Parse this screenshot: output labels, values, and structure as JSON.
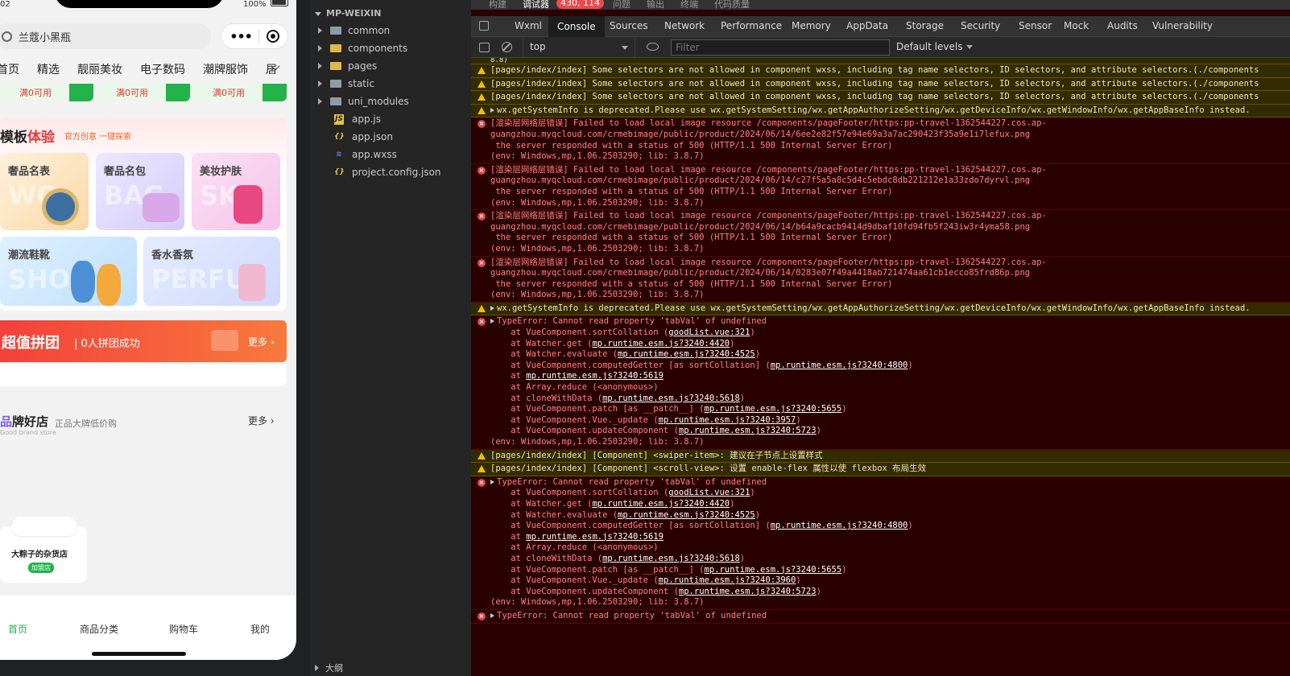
{
  "phone": {
    "status_time": "02",
    "status_battery": "100%",
    "search_text": "兰蔻小黑瓶",
    "tabs": [
      "首页",
      "精选",
      "靓丽美妆",
      "电子数码",
      "潮牌服饰",
      "居"
    ],
    "coupons": [
      "满0可用",
      "满0可用",
      "满0可用"
    ],
    "template_title_a": "模板",
    "template_title_b": "体验",
    "template_sub": "官方创意 一键探索",
    "tiles": [
      {
        "label": "奢品名表",
        "wm": "WO"
      },
      {
        "label": "奢品名包",
        "wm": "BAG"
      },
      {
        "label": "美妆护肤",
        "wm": "SKI"
      },
      {
        "label": "潮流鞋靴",
        "wm": "SHO"
      },
      {
        "label": "香水香氛",
        "wm": "PERFU"
      }
    ],
    "group_title": "超值拼团",
    "group_sub": "| 0人拼团成功",
    "group_more": "更多 ›",
    "brand_title_a": "品",
    "brand_title_b": "牌好店",
    "brand_sub": "正品大牌低价购",
    "brand_en": "Good brand store",
    "brand_more": "更多 ›",
    "shop_name": "大粽子的杂货店",
    "shop_badge": "加盟店",
    "tabbar": [
      "首页",
      "商品分类",
      "购物车",
      "我的"
    ],
    "colors": {
      "accent": "#24b24a",
      "red": "#e4393c"
    }
  },
  "tree": {
    "root": "MP-WEIXIN",
    "folders": [
      "common",
      "components",
      "pages",
      "static",
      "uni_modules"
    ],
    "files": [
      {
        "name": "app.js",
        "icon": "js-icon"
      },
      {
        "name": "app.json",
        "icon": "json-icon"
      },
      {
        "name": "app.wxss",
        "icon": "wxss-icon"
      },
      {
        "name": "project.config.json",
        "icon": "json-icon"
      }
    ],
    "outline": "大纲"
  },
  "devtools": {
    "top_tabs": [
      "构建",
      "调试器",
      "问题",
      "输出",
      "终端",
      "代码质量"
    ],
    "badge": "430, 114",
    "panels": [
      "Wxml",
      "Console",
      "Sources",
      "Network",
      "Performance",
      "Memory",
      "AppData",
      "Storage",
      "Security",
      "Sensor",
      "Mock",
      "Audits",
      "Vulnerability"
    ],
    "context": "top",
    "filter_placeholder": "Filter",
    "levels": "Default levels",
    "top_fragment": "8.8)",
    "logs": [
      {
        "type": "w",
        "lines": [
          "[pages/index/index] Some selectors are not allowed in component wxss, including tag name selectors, ID selectors, and attribute selectors.(./components"
        ]
      },
      {
        "type": "w",
        "lines": [
          "[pages/index/index] Some selectors are not allowed in component wxss, including tag name selectors, ID selectors, and attribute selectors.(./components"
        ]
      },
      {
        "type": "w",
        "lines": [
          "[pages/index/index] Some selectors are not allowed in component wxss, including tag name selectors, ID selectors, and attribute selectors.(./components"
        ]
      },
      {
        "type": "w",
        "tri": true,
        "lines": [
          "wx.getSystemInfo is deprecated.Please use wx.getSystemSetting/wx.getAppAuthorizeSetting/wx.getDeviceInfo/wx.getWindowInfo/wx.getAppBaseInfo instead."
        ]
      },
      {
        "type": "e",
        "lines": [
          "[渲染层网络层错误] Failed to load local image resource /components/pageFooter/https:pp-travel-1362544227.cos.ap-",
          "guangzhou.myqcloud.com/crmebimage/public/product/2024/06/14/6ee2e82f57e94e69a3a7ac290423f35a9e1i7lefux.png",
          " the server responded with a status of 500 (HTTP/1.1 500 Internal Server Error)",
          "(env: Windows,mp,1.06.2503290; lib: 3.8.7)"
        ]
      },
      {
        "type": "e",
        "lines": [
          "[渲染层网络层错误] Failed to load local image resource /components/pageFooter/https:pp-travel-1362544227.cos.ap-",
          "guangzhou.myqcloud.com/crmebimage/public/product/2024/06/14/c27f5a5a8c5d4c5ebdc8db221212e1a33zdo7dyrvl.png",
          " the server responded with a status of 500 (HTTP/1.1 500 Internal Server Error)",
          "(env: Windows,mp,1.06.2503290; lib: 3.8.7)"
        ]
      },
      {
        "type": "e",
        "lines": [
          "[渲染层网络层错误] Failed to load local image resource /components/pageFooter/https:pp-travel-1362544227.cos.ap-",
          "guangzhou.myqcloud.com/crmebimage/public/product/2024/06/14/b64a9cacb9414d9dbaf10fd94fb5f243iw3r4yma58.png",
          " the server responded with a status of 500 (HTTP/1.1 500 Internal Server Error)",
          "(env: Windows,mp,1.06.2503290; lib: 3.8.7)"
        ]
      },
      {
        "type": "e",
        "lines": [
          "[渲染层网络层错误] Failed to load local image resource /components/pageFooter/https:pp-travel-1362544227.cos.ap-",
          "guangzhou.myqcloud.com/crmebimage/public/product/2024/06/14/0283e07f49a4418ab721474aa61cb1ecco85frd86p.png",
          " the server responded with a status of 500 (HTTP/1.1 500 Internal Server Error)",
          "(env: Windows,mp,1.06.2503290; lib: 3.8.7)"
        ]
      },
      {
        "type": "w",
        "tri": true,
        "lines": [
          "wx.getSystemInfo is deprecated.Please use wx.getSystemSetting/wx.getAppAuthorizeSetting/wx.getDeviceInfo/wx.getWindowInfo/wx.getAppBaseInfo instead."
        ]
      },
      {
        "type": "e",
        "tri": true,
        "lines": [
          "TypeError: Cannot read property 'tabVal' of undefined",
          "    at VueComponent.sortCollation (goodList.vue:321)",
          "    at Watcher.get (mp.runtime.esm.js?3240:4420)",
          "    at Watcher.evaluate (mp.runtime.esm.js?3240:4525)",
          "    at VueComponent.computedGetter [as sortCollation] (mp.runtime.esm.js?3240:4800)",
          "    at mp.runtime.esm.js?3240:5619",
          "    at Array.reduce (<anonymous>)",
          "    at cloneWithData (mp.runtime.esm.js?3240:5618)",
          "    at VueComponent.patch [as __patch__] (mp.runtime.esm.js?3240:5655)",
          "    at VueComponent.Vue._update (mp.runtime.esm.js?3240:3957)",
          "    at VueComponent.updateComponent (mp.runtime.esm.js?3240:5723)",
          "(env: Windows,mp,1.06.2503290; lib: 3.8.7)"
        ]
      },
      {
        "type": "w",
        "lines": [
          "[pages/index/index] [Component] <swiper-item>: 建议在子节点上设置样式"
        ]
      },
      {
        "type": "w",
        "lines": [
          "[pages/index/index] [Component] <scroll-view>: 设置 enable-flex 属性以使 flexbox 布局生效"
        ]
      },
      {
        "type": "e",
        "tri": true,
        "lines": [
          "TypeError: Cannot read property 'tabVal' of undefined",
          "    at VueComponent.sortCollation (goodList.vue:321)",
          "    at Watcher.get (mp.runtime.esm.js?3240:4420)",
          "    at Watcher.evaluate (mp.runtime.esm.js?3240:4525)",
          "    at VueComponent.computedGetter [as sortCollation] (mp.runtime.esm.js?3240:4800)",
          "    at mp.runtime.esm.js?3240:5619",
          "    at Array.reduce (<anonymous>)",
          "    at cloneWithData (mp.runtime.esm.js?3240:5618)",
          "    at VueComponent.patch [as __patch__] (mp.runtime.esm.js?3240:5655)",
          "    at VueComponent.Vue._update (mp.runtime.esm.js?3240:3960)",
          "    at VueComponent.updateComponent (mp.runtime.esm.js?3240:5723)",
          "(env: Windows,mp,1.06.2503290; lib: 3.8.7)"
        ]
      },
      {
        "type": "e",
        "tri": true,
        "lines": [
          "TypeError: Cannot read property 'tabVal' of undefined"
        ]
      }
    ]
  }
}
